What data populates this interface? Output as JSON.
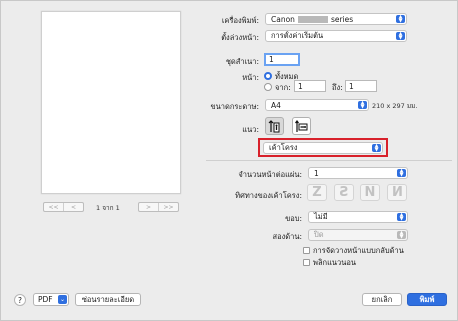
{
  "preview": {
    "page_label": "1 จาก 1",
    "nav_first": "<<",
    "nav_prev": "<",
    "nav_next": ">",
    "nav_last": ">>"
  },
  "printer": {
    "label": "เครื่องพิมพ์:",
    "value_prefix": "Canon",
    "value_suffix": "series"
  },
  "presets": {
    "label": "ตั้งล่วงหน้า:",
    "value": "การตั้งค่าเริ่มต้น"
  },
  "copies": {
    "label": "ชุดสำเนา:",
    "value": "1"
  },
  "pages": {
    "label": "หน้า:",
    "all_label": "ทั้งหมด",
    "from_label": "จาก:",
    "from_value": "1",
    "to_label": "ถึง:",
    "to_value": "1",
    "selected": "all"
  },
  "paper_size": {
    "label": "ขนาดกระดาษ:",
    "value": "A4",
    "dimensions": "210 x 297 มม."
  },
  "orientation": {
    "label": "แนว:",
    "selected": "portrait"
  },
  "section_menu": {
    "value": "เค้าโครง"
  },
  "layout": {
    "pages_per_sheet_label": "จำนวนหน้าต่อแผ่น:",
    "pages_per_sheet_value": "1",
    "direction_label": "ทิศทางของเค้าโครง:",
    "directions": [
      "Z",
      "S",
      "N",
      "N"
    ],
    "border_label": "ขอบ:",
    "border_value": "ไม่มี",
    "two_sided_label": "สองด้าน:",
    "two_sided_value": "ปิด",
    "reverse_orientation_label": "การจัดวางหน้าแบบกลับด้าน",
    "flip_horizontal_label": "พลิกแนวนอน"
  },
  "footer": {
    "help_label": "?",
    "pdf_label": "PDF",
    "hide_details_label": "ซ่อนรายละเอียด",
    "cancel_label": "ยกเลิก",
    "print_label": "พิมพ์"
  },
  "colors": {
    "accent": "#2f6fe0",
    "highlight": "#d8212b"
  }
}
